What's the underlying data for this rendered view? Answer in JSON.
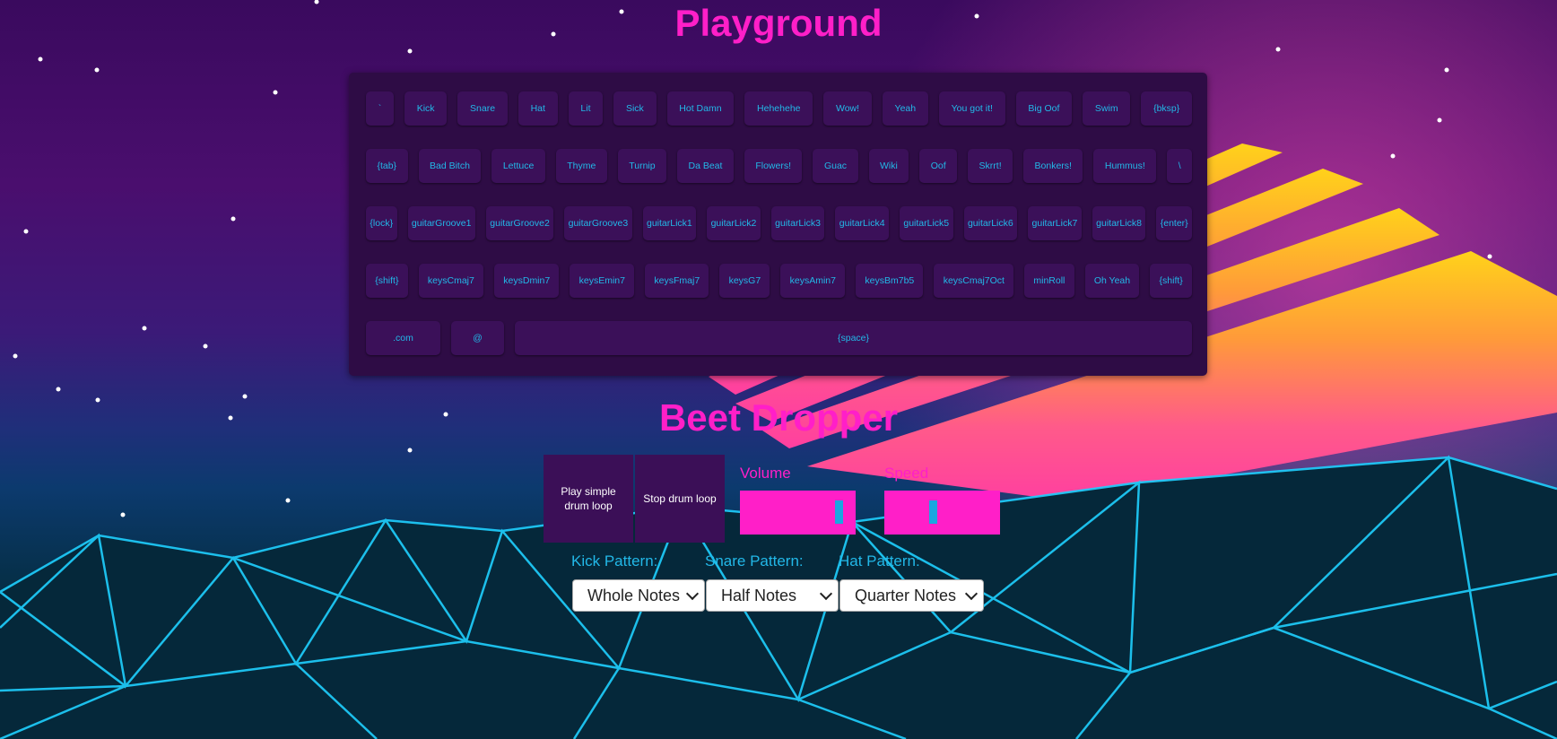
{
  "titles": {
    "playground": "Playground",
    "beet_dropper": "Beet Dropper"
  },
  "keyboard": {
    "rows": [
      [
        "`",
        "Kick",
        "Snare",
        "Hat",
        "Lit",
        "Sick",
        "Hot Damn",
        "Hehehehe",
        "Wow!",
        "Yeah",
        "You got it!",
        "Big Oof",
        "Swim",
        "{bksp}"
      ],
      [
        "{tab}",
        "Bad Bitch",
        "Lettuce",
        "Thyme",
        "Turnip",
        "Da Beat",
        "Flowers!",
        "Guac",
        "Wiki",
        "Oof",
        "Skrrt!",
        "Bonkers!",
        "Hummus!",
        "\\"
      ],
      [
        "{lock}",
        "guitarGroove1",
        "guitarGroove2",
        "guitarGroove3",
        "guitarLick1",
        "guitarLick2",
        "guitarLick3",
        "guitarLick4",
        "guitarLick5",
        "guitarLick6",
        "guitarLick7",
        "guitarLick8",
        "{enter}"
      ],
      [
        "{shift}",
        "keysCmaj7",
        "keysDmin7",
        "keysEmin7",
        "keysFmaj7",
        "keysG7",
        "keysAmin7",
        "keysBm7b5",
        "keysCmaj7Oct",
        "minRoll",
        "Oh Yeah",
        "{shift}"
      ],
      [
        ".com",
        "@",
        "{space}"
      ]
    ]
  },
  "controls": {
    "play_label": "Play simple drum loop",
    "stop_label": "Stop drum loop",
    "volume_label": "Volume",
    "speed_label": "Speed",
    "volume_value": 0.88,
    "speed_value": 0.42
  },
  "patterns": {
    "kick": {
      "label": "Kick Pattern:",
      "value": "Whole Notes"
    },
    "snare": {
      "label": "Snare Pattern:",
      "value": "Half Notes"
    },
    "hat": {
      "label": "Hat Pattern:",
      "value": "Quarter Notes"
    }
  },
  "colors": {
    "accent_pink": "#ff1fc8",
    "accent_blue": "#22b8e8",
    "key_bg": "#3b1059",
    "keyboard_bg": "#2e0c45"
  }
}
